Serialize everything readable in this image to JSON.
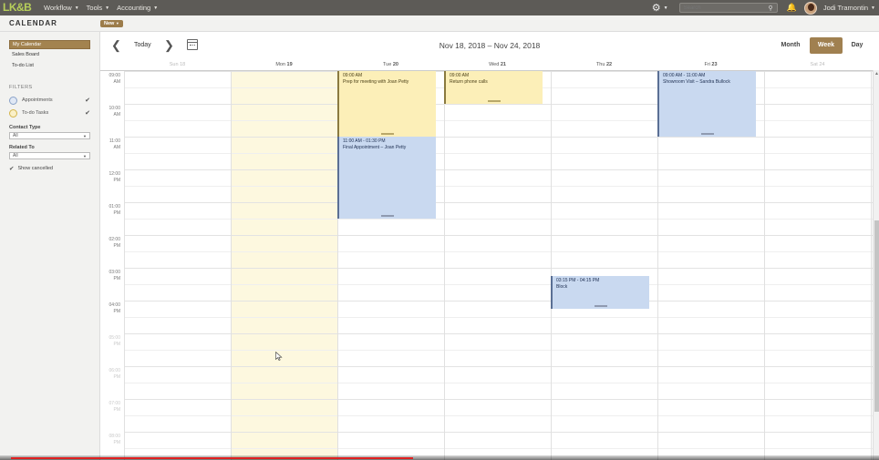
{
  "topnav": {
    "logo": "LK&B",
    "items": [
      {
        "label": "Workflow"
      },
      {
        "label": "Tools"
      },
      {
        "label": "Accounting"
      }
    ],
    "search_placeholder": "Search",
    "user_name": "Jodi Tramontin"
  },
  "header": {
    "title": "CALENDAR",
    "new_label": "New"
  },
  "sidebar": {
    "items": [
      {
        "label": "My Calendar"
      },
      {
        "label": "Sales Board"
      },
      {
        "label": "To-do List"
      }
    ],
    "filters_label": "FILTERS",
    "filters": [
      {
        "label": "Appointments",
        "checked": true
      },
      {
        "label": "To-do Tasks",
        "checked": true
      }
    ],
    "contact_type_label": "Contact Type",
    "contact_type_value": "All",
    "related_to_label": "Related To",
    "related_to_value": "All",
    "show_cancelled_label": "Show cancelled"
  },
  "toolbar": {
    "today_label": "Today",
    "date_range": "Nov 18, 2018 – Nov 24, 2018",
    "views": [
      "Month",
      "Week",
      "Day"
    ],
    "active_view": "Week"
  },
  "days": [
    {
      "name": "Sun",
      "num": "18"
    },
    {
      "name": "Mon",
      "num": "19"
    },
    {
      "name": "Tue",
      "num": "20"
    },
    {
      "name": "Wed",
      "num": "21"
    },
    {
      "name": "Thu",
      "num": "22"
    },
    {
      "name": "Fri",
      "num": "23"
    },
    {
      "name": "Sat",
      "num": "24"
    }
  ],
  "times": [
    {
      "h": "09:00",
      "ap": "AM"
    },
    {
      "h": "10:00",
      "ap": "AM"
    },
    {
      "h": "11:00",
      "ap": "AM"
    },
    {
      "h": "12:00",
      "ap": "PM"
    },
    {
      "h": "01:00",
      "ap": "PM"
    },
    {
      "h": "02:00",
      "ap": "PM"
    },
    {
      "h": "03:00",
      "ap": "PM"
    },
    {
      "h": "04:00",
      "ap": "PM"
    },
    {
      "h": "05:00",
      "ap": "PM"
    },
    {
      "h": "06:00",
      "ap": "PM"
    },
    {
      "h": "07:00",
      "ap": "PM"
    },
    {
      "h": "08:00",
      "ap": "PM"
    }
  ],
  "events": [
    {
      "day": 2,
      "type": "todo",
      "time": "09:00 AM",
      "title": "Prep for meeting with Joan Petty"
    },
    {
      "day": 3,
      "type": "todo",
      "time": "09:00 AM",
      "title": "Return phone calls"
    },
    {
      "day": 5,
      "type": "appt",
      "time": "09:00 AM - 11:00 AM",
      "title": "Showroom Visit – Sandra Bullock"
    },
    {
      "day": 2,
      "type": "appt",
      "time": "11:00 AM - 01:30 PM",
      "title": "Final Appointment – Joan Petty"
    },
    {
      "day": 4,
      "type": "appt",
      "time": "03:15 PM - 04:15 PM",
      "title": "Block"
    }
  ],
  "video_progress_percent": 47
}
